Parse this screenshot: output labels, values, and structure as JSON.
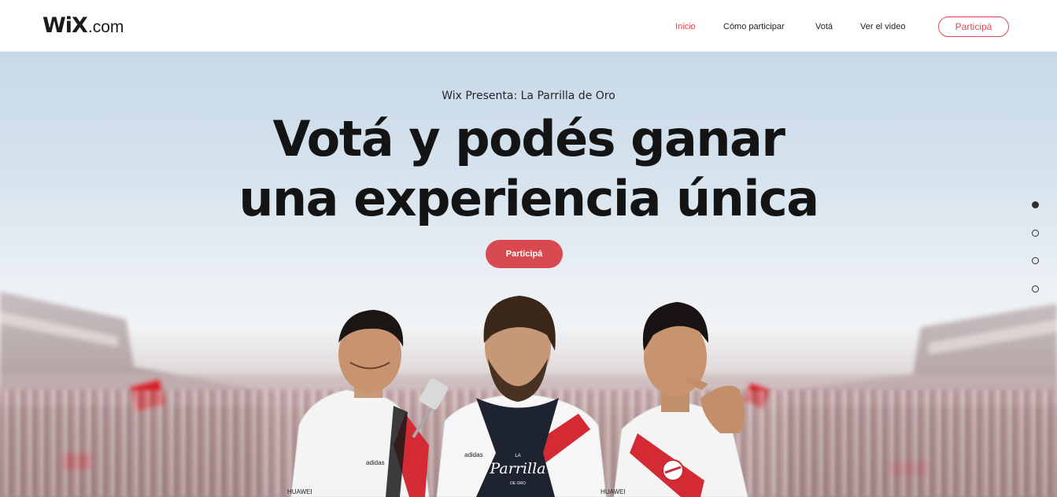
{
  "header": {
    "logo": {
      "wordmark": "WiX",
      "suffix": ".com"
    },
    "nav": [
      {
        "label": "Inicio",
        "active": true
      },
      {
        "label": "Cómo participar",
        "active": false
      },
      {
        "label": "Votá",
        "active": false
      },
      {
        "label": "Ver el video",
        "active": false
      }
    ],
    "cta_label": "Participá"
  },
  "hero": {
    "subtitle": "Wix Presenta: La Parrilla de Oro",
    "headline_line1": "Votá y podés ganar",
    "headline_line2": "una experiencia única",
    "cta_label": "Participá",
    "apron_text": {
      "line1": "LA",
      "line2": "Parrilla",
      "line3": "DE ORO"
    }
  },
  "slide_dots": {
    "count": 4,
    "active_index": 0
  },
  "colors": {
    "accent": "#d84a50",
    "nav_active": "#e8434b",
    "text_dark": "#141414",
    "header_bg": "#ffffff"
  },
  "icons": [
    "wix-logo",
    "slide-dot",
    "river-plate-badge",
    "adidas-logo",
    "huawei-logo"
  ]
}
